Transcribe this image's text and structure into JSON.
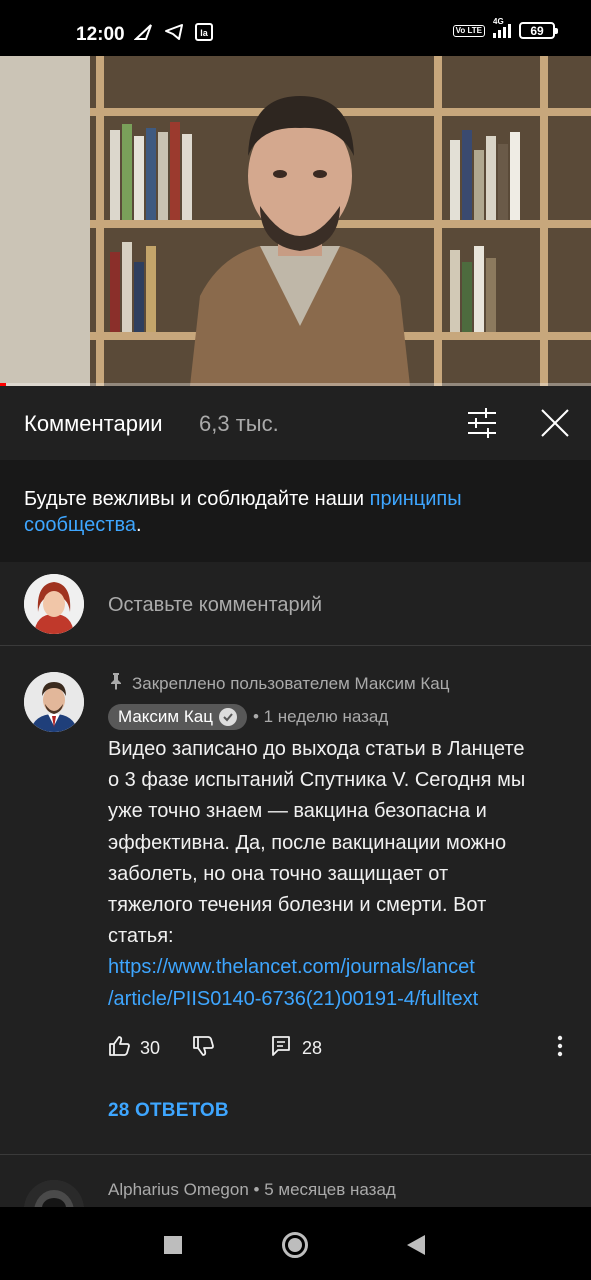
{
  "status_bar": {
    "time": "12:00",
    "network": "4G",
    "volte": "Vo LTE",
    "battery": "69",
    "left_icons": [
      "arrow-icon",
      "telegram-icon",
      "app-icon"
    ]
  },
  "video": {
    "progress_fraction": 0.01
  },
  "comments_header": {
    "title": "Комментарии",
    "count": "6,3 тыс."
  },
  "guidelines": {
    "text_before": "Будьте вежливы и соблюдайте наши ",
    "link_text": "принципы сообщества",
    "text_after": "."
  },
  "add_comment": {
    "placeholder": "Оставьте комментарий"
  },
  "pinned_comment": {
    "pinned_label": "Закреплено пользователем Максим Кац",
    "author": "Максим Кац",
    "time": "• 1 неделю назад",
    "lines": [
      "Видео записано до выхода статьи в Ланцете",
      "о 3 фазе испытаний Спутника V. Сегодня мы",
      "уже точно знаем — вакцина безопасна и",
      "эффективна. Да, после вакцинации можно",
      "заболеть, но она точно защищает от",
      "тяжелого течения болезни и смерти. Вот",
      "статья:"
    ],
    "link_lines": [
      "https://www.thelancet.com/journals/lancet",
      "/article/PIIS0140-6736(21)00191-4/fulltext"
    ],
    "likes": "30",
    "reply_count": "28",
    "replies_button": "28 ОТВЕТОВ"
  },
  "next_comment": {
    "author": "Alpharius Omegon",
    "time": "• 5 месяцев назад"
  },
  "colors": {
    "accent_link": "#3ea6ff",
    "panel_bg": "#212121",
    "guideline_bg": "#181818"
  }
}
